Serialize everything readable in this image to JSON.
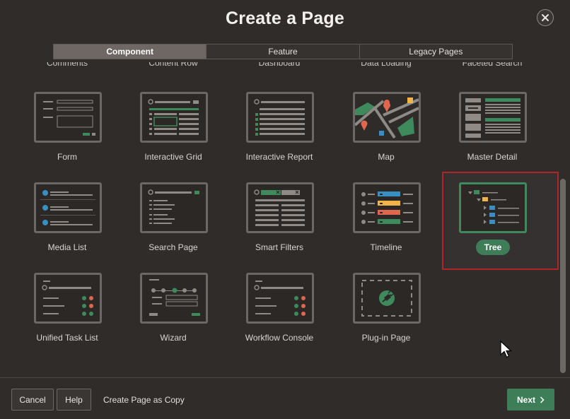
{
  "dialog": {
    "title": "Create a Page",
    "tabs": [
      {
        "label": "Component",
        "active": true
      },
      {
        "label": "Feature",
        "active": false
      },
      {
        "label": "Legacy Pages",
        "active": false
      }
    ],
    "cut_off_labels": [
      "Comments",
      "Content Row",
      "Dashboard",
      "Data Loading",
      "Faceted Search"
    ],
    "components": [
      {
        "label": "Form",
        "icon": "form-icon"
      },
      {
        "label": "Interactive Grid",
        "icon": "interactive-grid-icon"
      },
      {
        "label": "Interactive Report",
        "icon": "interactive-report-icon"
      },
      {
        "label": "Map",
        "icon": "map-icon"
      },
      {
        "label": "Master Detail",
        "icon": "master-detail-icon"
      },
      {
        "label": "Media List",
        "icon": "media-list-icon"
      },
      {
        "label": "Search Page",
        "icon": "search-page-icon"
      },
      {
        "label": "Smart Filters",
        "icon": "smart-filters-icon"
      },
      {
        "label": "Timeline",
        "icon": "timeline-icon"
      },
      {
        "label": "Tree",
        "icon": "tree-icon",
        "selected": true
      },
      {
        "label": "Unified Task List",
        "icon": "unified-task-list-icon"
      },
      {
        "label": "Wizard",
        "icon": "wizard-icon"
      },
      {
        "label": "Workflow Console",
        "icon": "workflow-console-icon"
      },
      {
        "label": "Plug-in Page",
        "icon": "plug-in-icon"
      }
    ],
    "footer": {
      "cancel": "Cancel",
      "help": "Help",
      "copy": "Create Page as Copy",
      "next": "Next"
    }
  },
  "colors": {
    "background": "#2f2c2a",
    "accent_green": "#3f7d58",
    "selection_outline": "#b1252a"
  }
}
